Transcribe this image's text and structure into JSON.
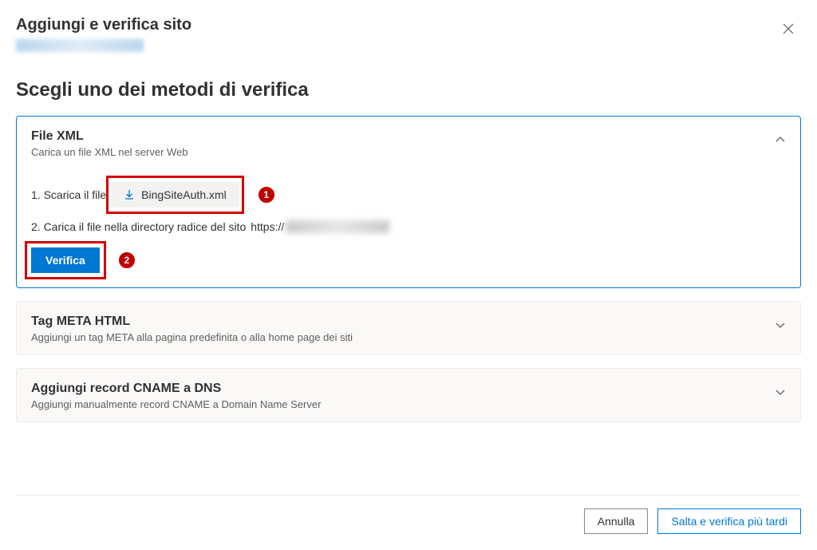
{
  "header": {
    "title": "Aggiungi e verifica sito"
  },
  "section_title": "Scegli uno dei metodi di verifica",
  "method_xml": {
    "title": "File XML",
    "desc": "Carica un file XML nel server Web",
    "step1_text": "1. Scarica il file",
    "download_label": "BingSiteAuth.xml",
    "step2_text": "2. Carica il file nella directory radice del sito",
    "step2_url_prefix": "https://",
    "verify_label": "Verifica",
    "badge1": "1",
    "badge2": "2"
  },
  "method_meta": {
    "title": "Tag META HTML",
    "desc": "Aggiungi un tag META alla pagina predefinita o alla home page dei siti"
  },
  "method_cname": {
    "title": "Aggiungi record CNAME a DNS",
    "desc": "Aggiungi manualmente record CNAME a Domain Name Server"
  },
  "footer": {
    "cancel": "Annulla",
    "later": "Salta e verifica più tardi"
  }
}
